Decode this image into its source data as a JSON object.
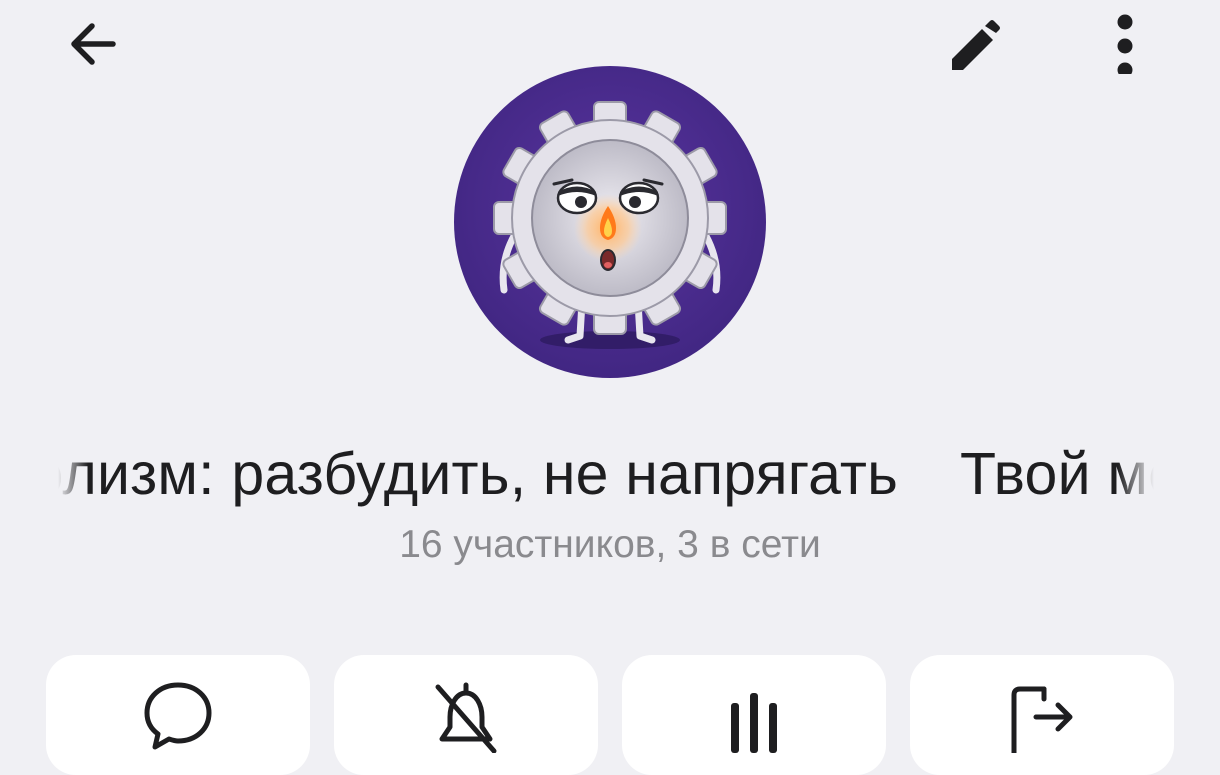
{
  "header": {
    "back_icon": "arrow-left-icon",
    "edit_icon": "pencil-icon",
    "menu_icon": "more-vertical-icon"
  },
  "profile": {
    "avatar_icon": "gear-mascot-avatar",
    "title": "Твой метаболизм: разбудить, не напрягать",
    "subtitle": "16 участников, 3 в сети"
  },
  "actions": [
    {
      "icon": "chat-bubble-icon"
    },
    {
      "icon": "bell-off-icon"
    },
    {
      "icon": "stats-bars-icon"
    },
    {
      "icon": "exit-icon"
    }
  ],
  "colors": {
    "background": "#f0f0f4",
    "avatar_bg": "#4a2a8a",
    "card": "#ffffff",
    "subtitle": "#8a8a8e"
  }
}
